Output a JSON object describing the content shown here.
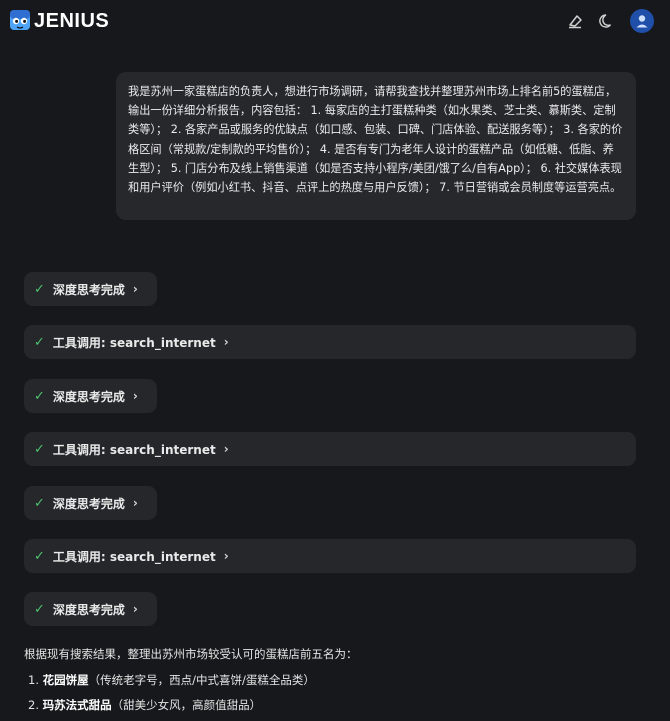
{
  "header": {
    "brand": "JENIUS",
    "icons": [
      "logo-icon",
      "clear-chat-icon",
      "moon-icon",
      "user-icon"
    ]
  },
  "user_message": "我是苏州一家蛋糕店的负责人，想进行市场调研，请帮我查找并整理苏州市场上排名前5的蛋糕店，输出一份详细分析报告，内容包括： 1. 每家店的主打蛋糕种类（如水果类、芝士类、慕斯类、定制类等）； 2. 各家产品或服务的优缺点（如口感、包装、口碑、门店体验、配送服务等）； 3. 各家的价格区间（常规款/定制款的平均售价）； 4. 是否有专门为老年人设计的蛋糕产品（如低糖、低脂、养生型）； 5. 门店分布及线上销售渠道（如是否支持小程序/美团/饿了么/自有App）； 6. 社交媒体表现和用户评价（例如小红书、抖音、点评上的热度与用户反馈）； 7. 节日营销或会员制度等运营亮点。",
  "steps": [
    {
      "label": "深度思考完成"
    },
    {
      "label": "工具调用: search_internet"
    },
    {
      "label": "深度思考完成"
    },
    {
      "label": "工具调用: search_internet"
    },
    {
      "label": "深度思考完成"
    },
    {
      "label": "工具调用: search_internet"
    },
    {
      "label": "深度思考完成"
    }
  ],
  "answer": {
    "intro": "根据现有搜索结果，整理出苏州市场较受认可的蛋糕店前五名为：",
    "items": [
      {
        "num": "1.",
        "name": "花园饼屋",
        "desc": "（传统老字号，西点/中式喜饼/蛋糕全品类）"
      },
      {
        "num": "2.",
        "name": "玛苏法式甜品",
        "desc": "（甜美少女风，高颜值甜品）"
      }
    ]
  },
  "colors": {
    "background": "#17181b",
    "bubble": "#27282c",
    "check": "#4cc26d",
    "avatar": "#1f4fa8"
  }
}
